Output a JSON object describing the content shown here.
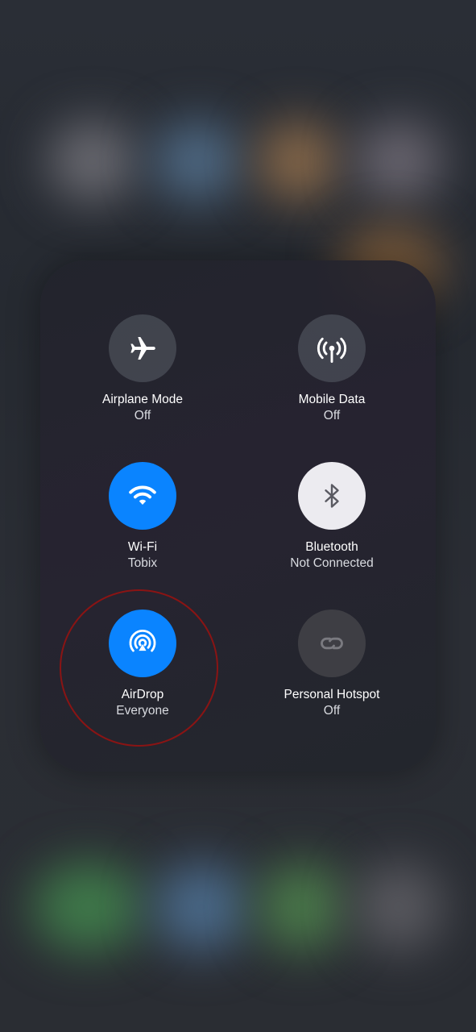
{
  "connectivity": {
    "airplane": {
      "label": "Airplane Mode",
      "status": "Off",
      "icon": "airplane-icon"
    },
    "mobile_data": {
      "label": "Mobile Data",
      "status": "Off",
      "icon": "antenna-icon"
    },
    "wifi": {
      "label": "Wi-Fi",
      "status": "Tobix",
      "icon": "wifi-icon"
    },
    "bluetooth": {
      "label": "Bluetooth",
      "status": "Not Connected",
      "icon": "bluetooth-icon"
    },
    "airdrop": {
      "label": "AirDrop",
      "status": "Everyone",
      "icon": "airdrop-icon"
    },
    "hotspot": {
      "label": "Personal Hotspot",
      "status": "Off",
      "icon": "link-icon"
    }
  },
  "colors": {
    "active_blue": "#0a84ff",
    "annotation_red": "#8a1414",
    "bluetooth_on": "#ecebf0"
  }
}
